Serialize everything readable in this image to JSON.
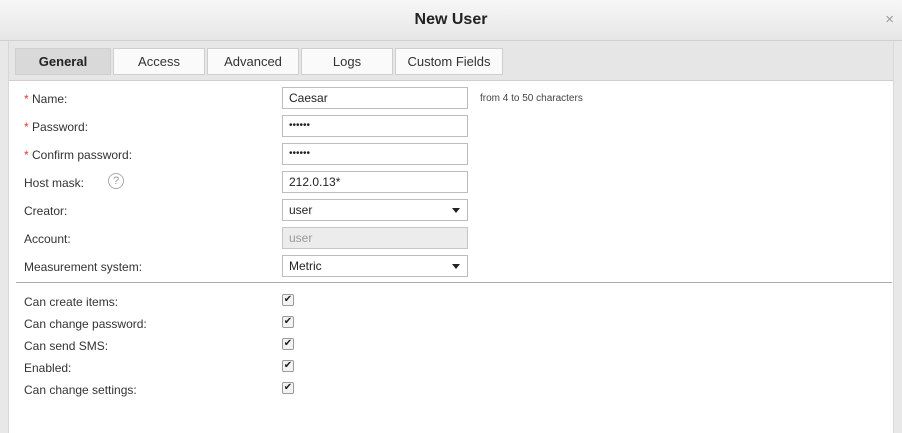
{
  "dialog": {
    "title": "New User",
    "close": "×"
  },
  "tabs": [
    {
      "label": "General"
    },
    {
      "label": "Access"
    },
    {
      "label": "Advanced"
    },
    {
      "label": "Logs"
    },
    {
      "label": "Custom Fields"
    }
  ],
  "form": {
    "required_mark": "*",
    "name": {
      "label": "Name:",
      "value": "Caesar",
      "hint": "from 4 to 50 characters"
    },
    "password": {
      "label": "Password:",
      "value": "••••••"
    },
    "confirm_password": {
      "label": "Confirm password:",
      "value": "••••••"
    },
    "host_mask": {
      "label": "Host mask:",
      "help": "?",
      "value": "212.0.13*"
    },
    "creator": {
      "label": "Creator:",
      "value": "user"
    },
    "account": {
      "label": "Account:",
      "value": "user"
    },
    "measurement_system": {
      "label": "Measurement system:",
      "value": "Metric"
    }
  },
  "checkbox_mark": "✔",
  "checkboxes": [
    {
      "label": "Can create items:",
      "checked": true
    },
    {
      "label": "Can change password:",
      "checked": true
    },
    {
      "label": "Can send SMS:",
      "checked": true
    },
    {
      "label": "Enabled:",
      "checked": true
    },
    {
      "label": "Can change settings:",
      "checked": true
    }
  ]
}
